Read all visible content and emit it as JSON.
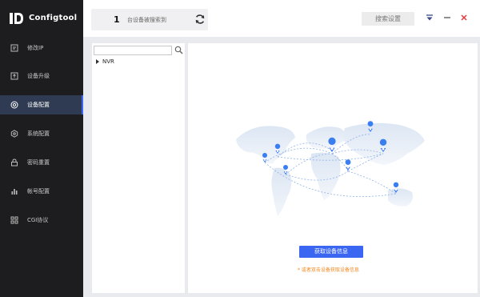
{
  "app": {
    "name": "Configtool"
  },
  "sidebar": {
    "items": [
      {
        "label": "修改IP",
        "icon": "edit-ip-icon"
      },
      {
        "label": "设备升级",
        "icon": "upgrade-icon"
      },
      {
        "label": "设备配置",
        "icon": "device-config-icon",
        "active": true
      },
      {
        "label": "系统配置",
        "icon": "system-config-icon"
      },
      {
        "label": "密码重置",
        "icon": "password-reset-icon"
      },
      {
        "label": "帐号配置",
        "icon": "account-config-icon"
      },
      {
        "label": "CGI协议",
        "icon": "cgi-protocol-icon"
      }
    ]
  },
  "topbar": {
    "device_count": "1",
    "device_count_text": "台设备被搜索到",
    "search_settings_label": "搜索设置"
  },
  "tree": {
    "search_value": "",
    "nodes": [
      {
        "label": "NVR",
        "expanded": false
      }
    ]
  },
  "main": {
    "get_info_button": "获取设备信息",
    "hint": "* 或者双击设备获取设备信息"
  },
  "colors": {
    "sidebar_bg": "#1d1d1f",
    "active_item_bg": "#2f3b52",
    "accent": "#3a66f2",
    "hint": "#f08a24",
    "close": "#e03a3a"
  }
}
